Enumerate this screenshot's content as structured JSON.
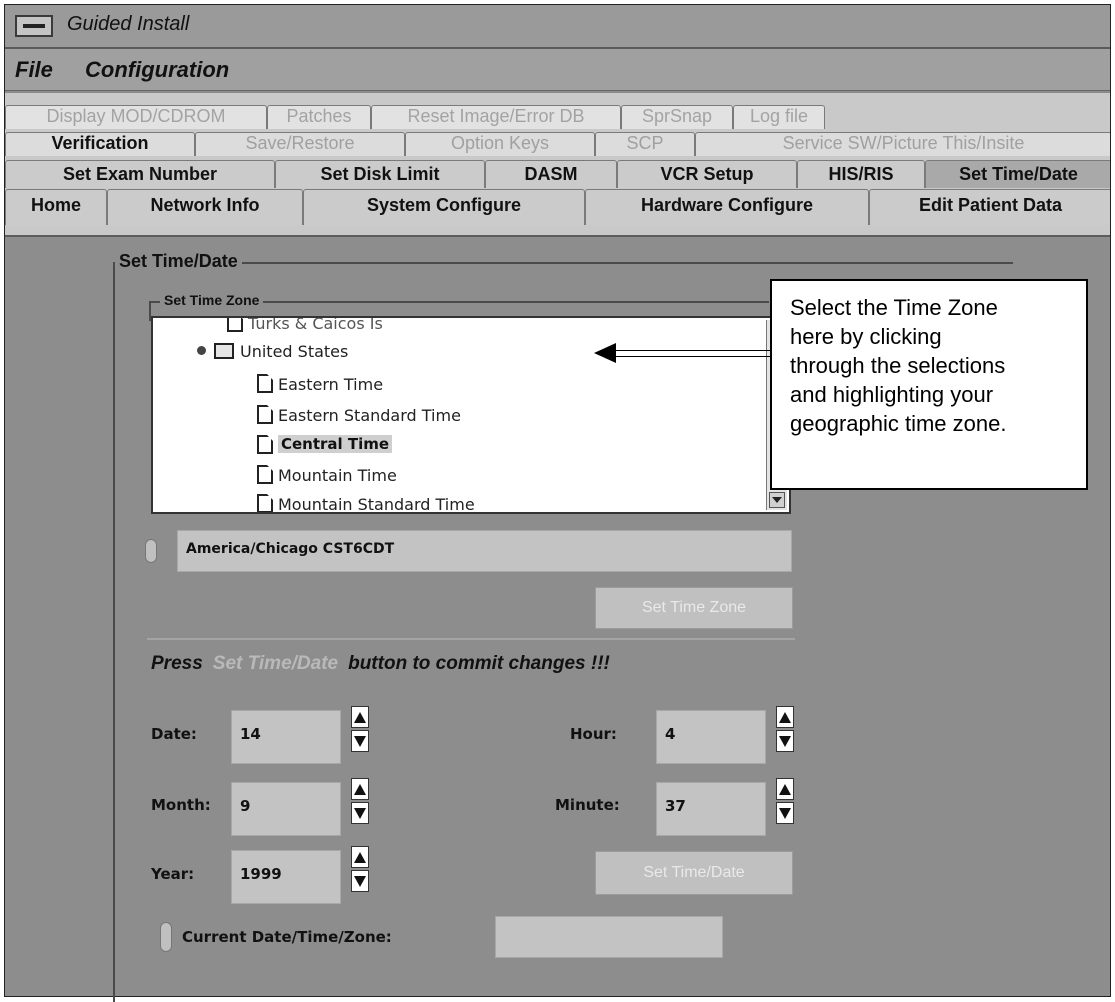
{
  "window": {
    "title": "Guided Install"
  },
  "menu": [
    "File",
    "Configuration"
  ],
  "tabs": {
    "row1": [
      "Display MOD/CDROM",
      "Patches",
      "Reset Image/Error DB",
      "SprSnap",
      "Log file"
    ],
    "row2": [
      "Verification",
      "Save/Restore",
      "Option Keys",
      "SCP",
      "Service SW/Picture This/Insite"
    ],
    "row3": [
      "Set Exam Number",
      "Set Disk Limit",
      "DASM",
      "VCR Setup",
      "HIS/RIS",
      "Set Time/Date"
    ],
    "row4": [
      "Home",
      "Network Info",
      "System Configure",
      "Hardware Configure",
      "Edit Patient Data"
    ],
    "selected": "Set Time/Date"
  },
  "panel": {
    "title": "Set Time/Date",
    "timezone_group_title": "Set Time Zone",
    "tree": [
      "Turks & Caicos Is",
      "United States",
      "Eastern Time",
      "Eastern Standard Time",
      "Central Time",
      "Mountain Time",
      "Mountain Standard Time"
    ],
    "selected_zone": "Central Time",
    "zone_field": "America/Chicago  CST6CDT",
    "set_zone_button": "Set Time Zone",
    "press_before": "Press",
    "press_ghost": "Set Time/Date",
    "press_after": "button to commit changes !!!",
    "date": {
      "label": "Date:",
      "value": "14"
    },
    "month": {
      "label": "Month:",
      "value": "9"
    },
    "year": {
      "label": "Year:",
      "value": "1999"
    },
    "hour": {
      "label": "Hour:",
      "value": "4"
    },
    "minute": {
      "label": "Minute:",
      "value": "37"
    },
    "set_date_button": "Set Time/Date",
    "current_label": "Current Date/Time/Zone:",
    "current_value": ""
  },
  "callout": {
    "lines": [
      "Select the Time Zone",
      "here by clicking",
      "through the selections",
      "and highlighting your",
      "geographic time zone."
    ]
  }
}
